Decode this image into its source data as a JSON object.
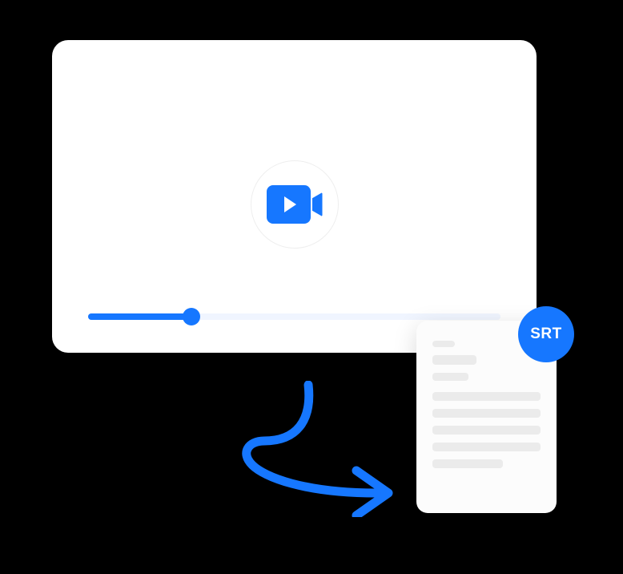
{
  "illustration": {
    "srt_badge_label": "SRT",
    "progress_percent": 25,
    "accent_color": "#1677ff"
  }
}
